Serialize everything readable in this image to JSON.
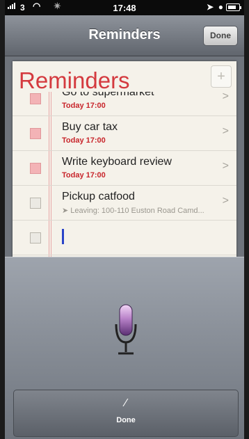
{
  "status_bar": {
    "carrier": "3",
    "time": "17:48"
  },
  "nav": {
    "title": "Reminders",
    "done_label": "Done"
  },
  "list": {
    "header_title": "Reminders",
    "add_icon": "plus-icon",
    "items": [
      {
        "name": "Go to supermarket",
        "detail": "Today 17:00",
        "checkbox": "red"
      },
      {
        "name": "Buy car tax",
        "detail": "Today 17:00",
        "checkbox": "red"
      },
      {
        "name": "Write keyboard review",
        "detail": "Today 17:00",
        "checkbox": "red"
      },
      {
        "name": "Pickup catfood",
        "detail": "Leaving: 100-110 Euston Road Camd...",
        "checkbox": "gray"
      }
    ]
  },
  "dictation": {
    "mic_icon": "microphone-icon",
    "done_label": "Done"
  },
  "colors": {
    "accent_red": "#d43a3f",
    "cursor_blue": "#2a44c8"
  }
}
